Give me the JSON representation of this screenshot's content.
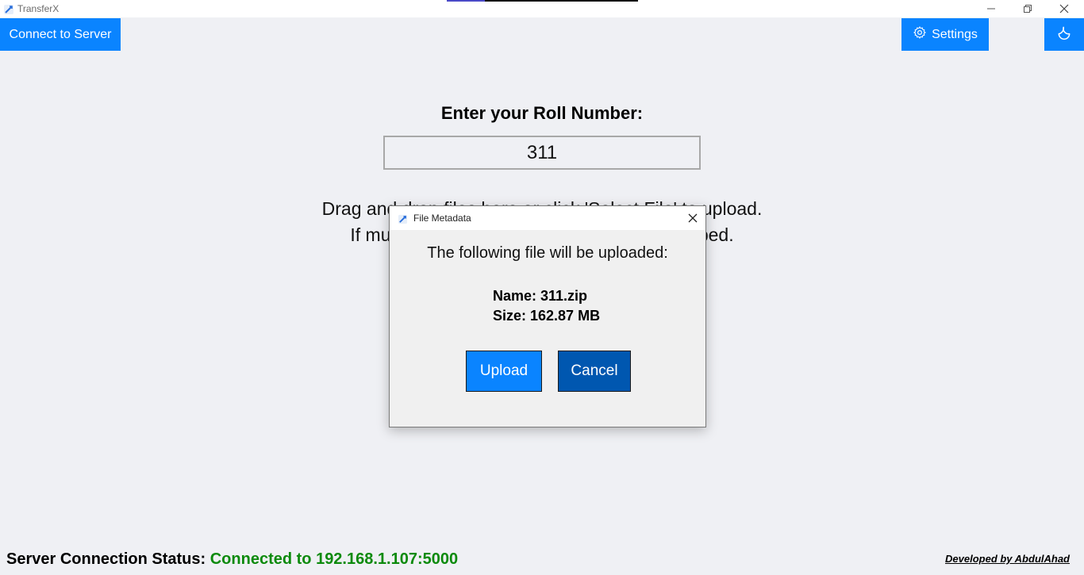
{
  "window": {
    "title": "TransferX",
    "controls": {
      "minimize_icon": "minimize-icon",
      "maximize_icon": "restore-icon",
      "close_icon": "close-icon"
    }
  },
  "toolbar": {
    "connect_label": "Connect to Server",
    "settings_label": "Settings",
    "settings_icon": "gear-icon",
    "theme_icon": "moon-icon",
    "accent_color": "#0a84ff"
  },
  "main": {
    "roll_label": "Enter your Roll Number:",
    "roll_value": "311",
    "instruction_line1": "Drag and drop files here or click 'Select File' to upload.",
    "instruction_line2": "If multiple files are dropped, they will be zipped."
  },
  "dialog": {
    "title": "File Metadata",
    "message": "The following file will be uploaded:",
    "name_line": "Name: 311.zip",
    "size_line": "Size: 162.87 MB",
    "upload_label": "Upload",
    "cancel_label": "Cancel"
  },
  "footer": {
    "status_label": "Server Connection Status:",
    "status_value": "Connected to 192.168.1.107:5000",
    "status_color": "#0c8a0c",
    "developed_by": "Developed by AbdulAhad"
  }
}
